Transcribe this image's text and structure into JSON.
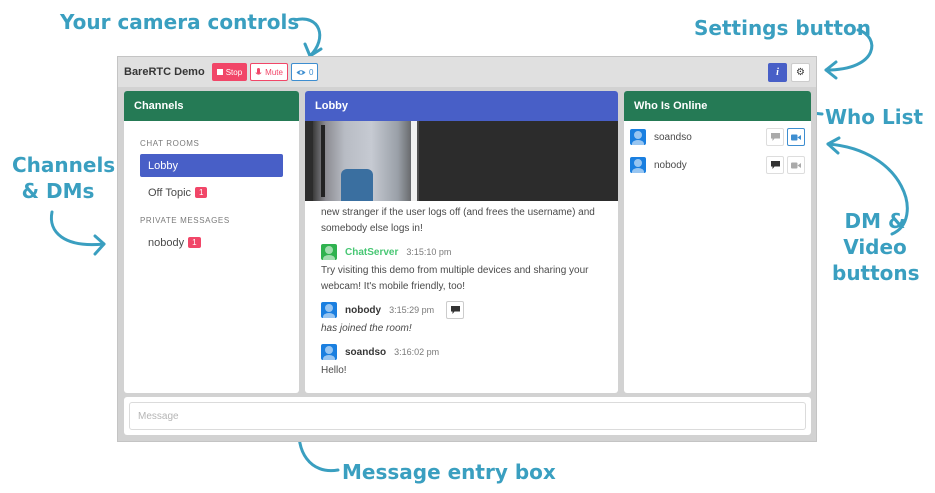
{
  "annotations": {
    "camera_controls": "Your camera controls",
    "settings_button": "Settings button",
    "channels_dms_line1": "Channels",
    "channels_dms_line2": "& DMs",
    "who_list": "Who List",
    "dm_video_line1": "DM &",
    "dm_video_line2": "Video",
    "dm_video_line3": "buttons",
    "message_entry": "Message entry box"
  },
  "app": {
    "title": "BareRTC Demo",
    "stop_label": "Stop",
    "mute_label": "Mute",
    "watchers_count": "0"
  },
  "channels": {
    "header": "Channels",
    "rooms_label": "CHAT ROOMS",
    "rooms": [
      {
        "label": "Lobby",
        "active": true
      },
      {
        "label": "Off Topic",
        "unread": "1"
      }
    ],
    "pm_label": "PRIVATE MESSAGES",
    "pms": [
      {
        "label": "nobody",
        "unread": "1"
      }
    ]
  },
  "lobby": {
    "header": "Lobby",
    "partial_text": "new stranger if the user logs off (and frees the username) and somebody else logs in!",
    "messages": [
      {
        "user": "ChatServer",
        "time": "3:15:10 pm",
        "text": "Try visiting this demo from multiple devices and sharing your webcam! It's mobile friendly, too!"
      },
      {
        "user": "nobody",
        "time": "3:15:29 pm",
        "text": "has joined the room!"
      },
      {
        "user": "soandso",
        "time": "3:16:02 pm",
        "text": "Hello!"
      }
    ]
  },
  "online": {
    "header": "Who Is Online",
    "users": [
      {
        "name": "soandso"
      },
      {
        "name": "nobody"
      }
    ]
  },
  "message_box": {
    "placeholder": "Message"
  },
  "colors": {
    "accent": "#3a9fc0",
    "green_header": "#257a55",
    "blue_header": "#485fc7",
    "danger": "#f14668"
  },
  "icons": [
    "stop-icon",
    "microphone-icon",
    "eye-icon",
    "info-icon",
    "gear-icon",
    "chat-bubble-icon",
    "video-camera-icon",
    "avatar-icon"
  ]
}
